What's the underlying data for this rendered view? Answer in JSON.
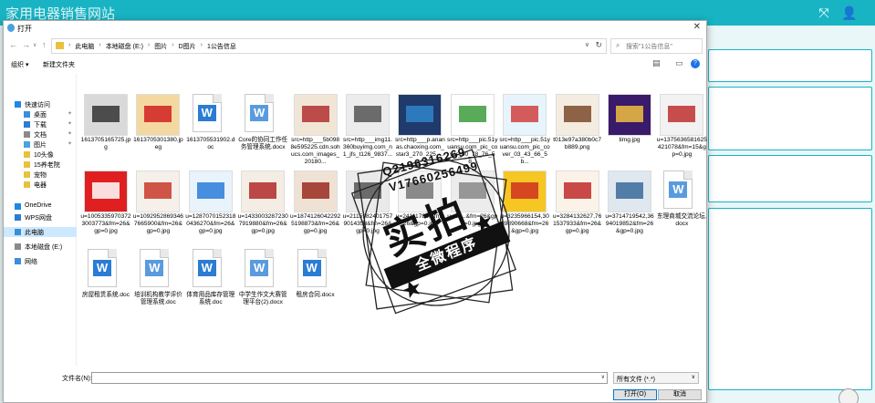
{
  "app": {
    "title": "家用电器销售网站"
  },
  "dialog": {
    "title": "打开",
    "breadcrumbs": [
      "此电脑",
      "本地磁盘 (E:)",
      "图片",
      "D图片",
      "1公告信息"
    ],
    "search_placeholder": "搜索\"1公告信息\"",
    "toolbar": {
      "organize": "组织 ▾",
      "new_folder": "新建文件夹"
    },
    "sidebar": [
      {
        "label": "快速访问",
        "icon": "star-icon",
        "color": "#1e88e5",
        "indent": 0,
        "pinned": false,
        "selected": false
      },
      {
        "label": "桌面",
        "icon": "desktop-icon",
        "color": "#3a8fd8",
        "indent": 1,
        "pinned": true,
        "selected": false
      },
      {
        "label": "下载",
        "icon": "download-icon",
        "color": "#2b7cd3",
        "indent": 1,
        "pinned": true,
        "selected": false
      },
      {
        "label": "文档",
        "icon": "documents-icon",
        "color": "#8a8a8a",
        "indent": 1,
        "pinned": true,
        "selected": false
      },
      {
        "label": "图片",
        "icon": "pictures-icon",
        "color": "#4aa3df",
        "indent": 1,
        "pinned": true,
        "selected": false
      },
      {
        "label": "10头像",
        "icon": "folder-icon",
        "color": "#e8c23e",
        "indent": 1,
        "pinned": false,
        "selected": false
      },
      {
        "label": "15养老院",
        "icon": "folder-icon",
        "color": "#e8c23e",
        "indent": 1,
        "pinned": false,
        "selected": false
      },
      {
        "label": "宠物",
        "icon": "folder-icon",
        "color": "#e8c23e",
        "indent": 1,
        "pinned": false,
        "selected": false
      },
      {
        "label": "电器",
        "icon": "folder-icon",
        "color": "#e8c23e",
        "indent": 1,
        "pinned": false,
        "selected": false
      },
      {
        "label": "OneDrive",
        "icon": "cloud-icon",
        "color": "#1e88e5",
        "indent": 0,
        "pinned": false,
        "selected": false
      },
      {
        "label": "WPS网盘",
        "icon": "cloud-drive-icon",
        "color": "#2b7cd3",
        "indent": 0,
        "pinned": false,
        "selected": false
      },
      {
        "label": "此电脑",
        "icon": "computer-icon",
        "color": "#3a8fd8",
        "indent": 0,
        "pinned": false,
        "selected": true
      },
      {
        "label": "本地磁盘 (E:)",
        "icon": "disk-icon",
        "color": "#8a8a8a",
        "indent": 0,
        "pinned": false,
        "selected": false
      },
      {
        "label": "网络",
        "icon": "network-icon",
        "color": "#3a8fd8",
        "indent": 0,
        "pinned": false,
        "selected": false
      }
    ],
    "files_row1": [
      {
        "name": "1613705165725.jpg",
        "kind": "image",
        "c1": "#d9d9d9",
        "c2": "#333333"
      },
      {
        "name": "1613705301380.jpeg",
        "kind": "image",
        "c1": "#f3d9a0",
        "c2": "#d02020"
      },
      {
        "name": "1613705531902.doc",
        "kind": "doc"
      },
      {
        "name": "Core的协同工作任务管理系统.docx",
        "kind": "doc"
      },
      {
        "name": "src=http___5b0988e595225.cdn.sohucs.com_images_20180...",
        "kind": "image",
        "c1": "#f1e6d6",
        "c2": "#b33030"
      },
      {
        "name": "src=http___img11.360buyimg.com_n1_jfs_t126_9837...",
        "kind": "image",
        "c1": "#ececec",
        "c2": "#555555"
      },
      {
        "name": "src=http___p.ananas.chaoxing.com_star3_270_225_...",
        "kind": "image",
        "c1": "#1f3a6b",
        "c2": "#2f86c9"
      },
      {
        "name": "src=http___pic.51yuansu.com_pic_cover_00_78_76_58...",
        "kind": "image",
        "c1": "#ffffff",
        "c2": "#3c9b3c"
      },
      {
        "name": "src=http___pic.51yuansu.com_pic_cover_03_43_66_5b...",
        "kind": "image",
        "c1": "#e7f4fb",
        "c2": "#d04040"
      },
      {
        "name": "t013e97a380b0c7b889.png",
        "kind": "image",
        "c1": "#f4ece0",
        "c2": "#7a4a2a"
      },
      {
        "name": "timg.jpg",
        "kind": "image",
        "c1": "#3a1a6a",
        "c2": "#f0c040"
      },
      {
        "name": "u=1375636581625421078&fm=15&gp=0.jpg",
        "kind": "image",
        "c1": "#f2f2f2",
        "c2": "#c03030"
      }
    ],
    "files_row2": [
      {
        "name": "u=10053359703723003773&fm=26&gp=0.jpg",
        "kind": "image",
        "c1": "#e02020",
        "c2": "#ffffff"
      },
      {
        "name": "u=10929528693467665900&fm=26&gp=0.jpg",
        "kind": "image",
        "c1": "#f5f0ea",
        "c2": "#c83a2a"
      },
      {
        "name": "u=12870701523180436270&fm=26&gp=0.jpg",
        "kind": "image",
        "c1": "#e9f3fb",
        "c2": "#2a7bd8"
      },
      {
        "name": "u=14330032872307919880&fm=26&gp=0.jpg",
        "kind": "image",
        "c1": "#f4ede4",
        "c2": "#b02a2a"
      },
      {
        "name": "u=18741260422925198873&fm=26&gp=0.jpg",
        "kind": "image",
        "c1": "#efe2d4",
        "c2": "#9a2a20"
      },
      {
        "name": "u=21159824017579014358&fm=26&gp=0.jpg",
        "kind": "image",
        "c1": "#eaeaea",
        "c2": "#555555"
      },
      {
        "name": "u=2411178...&fm=26&gp=0.jpg",
        "kind": "image",
        "c1": "#f4f4f4",
        "c2": "#777777"
      },
      {
        "name": "u=29...&fm=26&gp=0.jpg",
        "kind": "image",
        "c1": "#ececec",
        "c2": "#888888"
      },
      {
        "name": "u=3235966154,3089890668&fm=26&gp=0.jpg",
        "kind": "image",
        "c1": "#f6c623",
        "c2": "#d03020"
      },
      {
        "name": "u=3284132627,761537933&fm=26&gp=0.jpg",
        "kind": "image",
        "c1": "#fbf3e8",
        "c2": "#c02a2a"
      },
      {
        "name": "u=3714719542,3694019852&fm=26&gp=0.jpg",
        "kind": "image",
        "c1": "#dfe7ef",
        "c2": "#3a6a9a"
      },
      {
        "name": "东理商城交流论坛.docx",
        "kind": "doc"
      }
    ],
    "files_row3": [
      {
        "name": "房屋租赁系统.doc",
        "kind": "doc"
      },
      {
        "name": "培训机构教学评价管理系统.doc",
        "kind": "doc"
      },
      {
        "name": "体育用品库存管理系统.doc",
        "kind": "doc"
      },
      {
        "name": "中学生作文大赛管理平台(2).docx",
        "kind": "doc"
      },
      {
        "name": "租房合同.docx",
        "kind": "doc"
      }
    ],
    "filename_label": "文件名(N):",
    "filetype": "所有文件 (*.*)",
    "open_button": "打开(O)",
    "cancel_button": "取消"
  },
  "watermark": {
    "line1": "Q2196316269",
    "line2": "V17660256499",
    "main": "实拍",
    "band": "全微程序"
  }
}
